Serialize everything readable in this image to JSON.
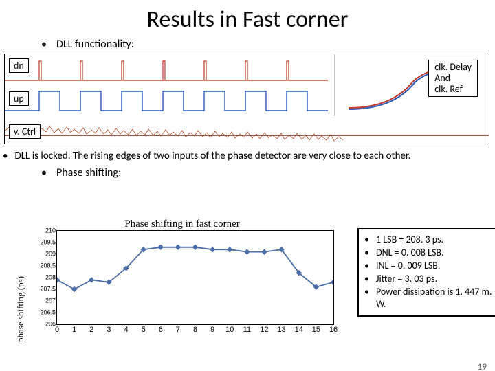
{
  "title": "Results in Fast corner",
  "bullets": {
    "dll_func": "DLL functionality:",
    "phase": "Phase shifting:"
  },
  "wave": {
    "dn": "dn",
    "up": "up",
    "vctrl": "v. Ctrl",
    "clk": "clk. Delay\nAnd\nclk. Ref"
  },
  "locked": "DLL is locked. The rising edges of two inputs of the phase detector are very close to each other.",
  "axis": {
    "ylabel": "phase shifting (ps)",
    "title": "Phase shifting in fast corner"
  },
  "specs": {
    "lsb": "1 LSB = 208. 3 ps.",
    "dnl": "DNL =  0. 008 LSB.",
    "inl": "INL = 0. 009 LSB.",
    "jit": "Jitter =  3. 03 ps.",
    "pow": "Power dissipation is 1. 447 m. W."
  },
  "page": "19",
  "chart_data": {
    "type": "line",
    "title": "Phase shifting in fast corner",
    "xlabel": "",
    "ylabel": "phase shifting (ps)",
    "ylim": [
      206,
      210
    ],
    "yticks": [
      206,
      206.5,
      207,
      207.5,
      208,
      208.5,
      209,
      209.5,
      210
    ],
    "x": [
      0,
      1,
      2,
      3,
      4,
      5,
      6,
      7,
      8,
      9,
      10,
      11,
      12,
      13,
      14,
      15,
      16
    ],
    "values": [
      207.9,
      207.5,
      207.9,
      207.8,
      208.4,
      209.2,
      209.3,
      209.3,
      209.3,
      209.2,
      209.2,
      209.1,
      209.1,
      209.2,
      208.2,
      207.6,
      207.8
    ]
  }
}
